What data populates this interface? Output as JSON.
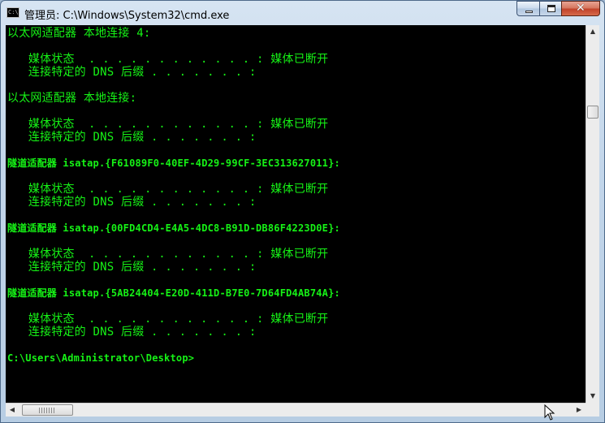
{
  "window": {
    "title": "管理员: C:\\Windows\\System32\\cmd.exe",
    "app_icon_text": "C:\\"
  },
  "console": {
    "text_color": "#16f216",
    "background": "#000000",
    "lines": [
      "以太网适配器 本地连接 4:",
      "",
      "   媒体状态  . . . . . . . . . . . . : 媒体已断开",
      "   连接特定的 DNS 后缀 . . . . . . . :",
      "",
      "以太网适配器 本地连接:",
      "",
      "   媒体状态  . . . . . . . . . . . . : 媒体已断开",
      "   连接特定的 DNS 后缀 . . . . . . . :",
      "",
      "隧道适配器 isatap.{F61089F0-40EF-4D29-99CF-3EC313627011}:",
      "",
      "   媒体状态  . . . . . . . . . . . . : 媒体已断开",
      "   连接特定的 DNS 后缀 . . . . . . . :",
      "",
      "隧道适配器 isatap.{00FD4CD4-E4A5-4DC8-B91D-DB86F4223D0E}:",
      "",
      "   媒体状态  . . . . . . . . . . . . : 媒体已断开",
      "   连接特定的 DNS 后缀 . . . . . . . :",
      "",
      "隧道适配器 isatap.{5AB24404-E20D-411D-B7E0-7D64FD4AB74A}:",
      "",
      "   媒体状态  . . . . . . . . . . . . : 媒体已断开",
      "   连接特定的 DNS 后缀 . . . . . . . :",
      "",
      "C:\\Users\\Administrator\\Desktop>"
    ]
  }
}
